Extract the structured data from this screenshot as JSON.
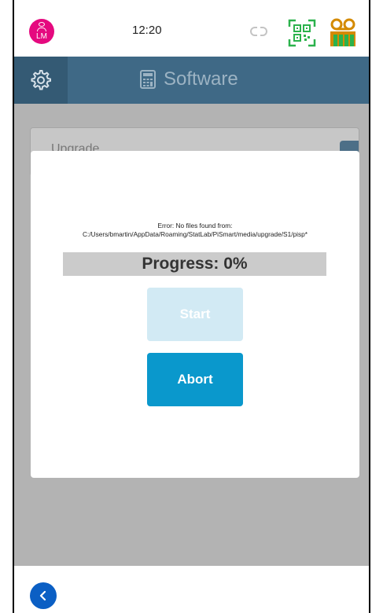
{
  "status_bar": {
    "avatar_initials": "LM",
    "time": "12:20"
  },
  "header": {
    "title": "Software"
  },
  "background_list": {
    "item_label": "Upgrade"
  },
  "dialog": {
    "error_message": "Error: No files found from: C:/Users/bmartin/AppData/Roaming/StatLab/PiSmart/media/upgrade/S1/pisp*",
    "progress_text": "Progress: 0%",
    "progress_value": 0,
    "start_label": "Start",
    "start_enabled": false,
    "abort_label": "Abort"
  },
  "icons": {
    "user": "user-icon",
    "link": "link-icon",
    "qr": "qr-code-icon",
    "tape": "cassette-icon",
    "settings": "gear-icon",
    "calculator": "calculator-icon",
    "back": "chevron-left-icon"
  },
  "colors": {
    "avatar": "#e5097f",
    "header": "#3f6986",
    "accent": "#0a98cc",
    "accent_disabled": "#d2eaf4",
    "back_button": "#0b5fc4",
    "qr_icon": "#2bb24c",
    "tape_icon": "#d48a00"
  }
}
